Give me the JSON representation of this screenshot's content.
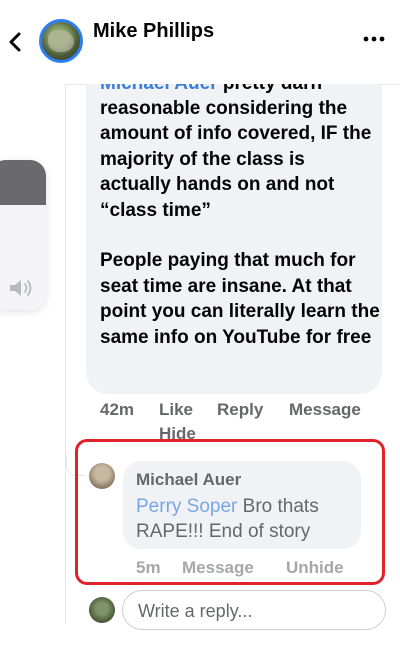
{
  "header": {
    "title": "Mike Phillips",
    "back_icon": "chevron-left-icon",
    "more_icon": "more-horizontal-icon"
  },
  "volume": {
    "icon": "speaker-icon",
    "level": 0.3
  },
  "main_comment": {
    "mention": "Michael Auer",
    "mention_trailing": " pretty darn",
    "body": "reasonable considering the amount of info covered, IF the majority of the class is actually hands on and not “class time”\n\nPeople paying that much for seat time are insane. At that point you can literally learn the same info on YouTube for free",
    "time": "42m",
    "actions": [
      "Like",
      "Reply",
      "Message",
      "Hide"
    ]
  },
  "reply": {
    "author": "Michael Auer",
    "mention": "Perry Soper",
    "text": " Bro thats RAPE!!! End of story",
    "time": "5m",
    "actions": [
      "Message",
      "Unhide"
    ]
  },
  "composer": {
    "placeholder": "Write a reply..."
  },
  "colors": {
    "accent": "#2e7ef0",
    "mention": "#3b7ddd",
    "highlight": "#e2222b",
    "bubble": "#f0f2f5",
    "meta": "#65676b"
  }
}
